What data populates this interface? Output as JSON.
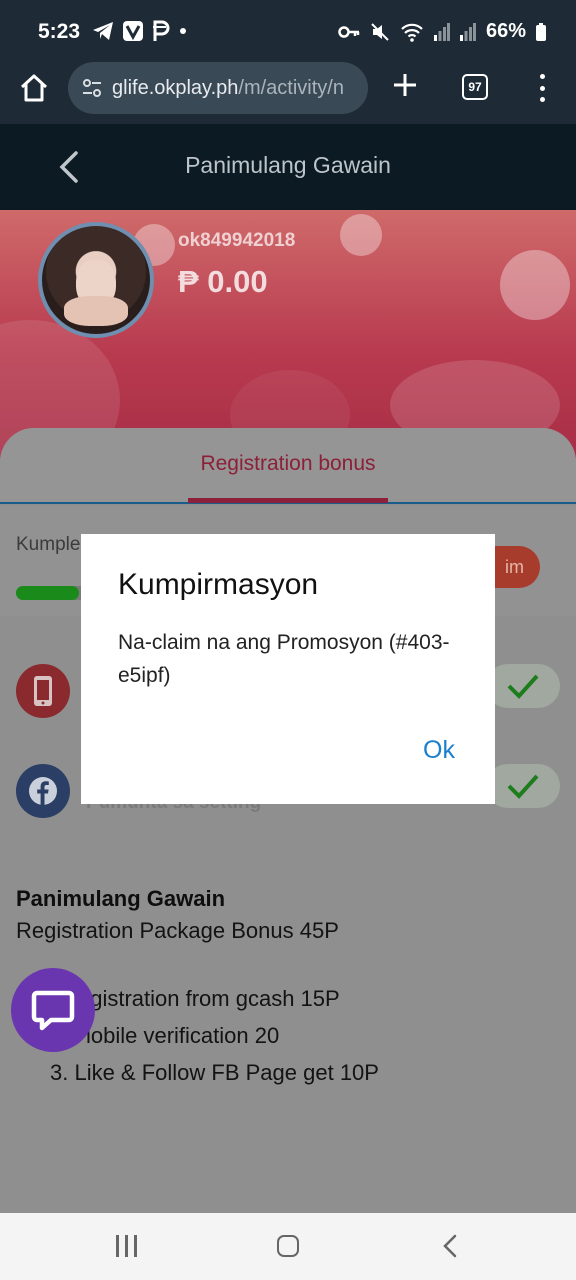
{
  "status_bar": {
    "time": "5:23",
    "battery": "66%"
  },
  "browser": {
    "url_host": "glife.okplay.ph",
    "url_path": "/m/activity/n",
    "tab_count": "97"
  },
  "header": {
    "title": "Panimulang Gawain"
  },
  "profile": {
    "username": "ok849942018",
    "balance": "₱ 0.00"
  },
  "tabs": [
    {
      "label": "Registration bonus",
      "active": true
    }
  ],
  "progress": {
    "label": "Kumple",
    "fraction": 0.15,
    "claim_label": "im"
  },
  "tasks": [
    {
      "icon": "phone-icon",
      "color": "#c8232f",
      "desc": "",
      "completed": true
    },
    {
      "icon": "facebook-icon",
      "color": "#2d54a0",
      "desc": "Pumunta sa setting",
      "completed": true
    }
  ],
  "info": {
    "title": "Panimulang Gawain",
    "subtitle": "Registration Package Bonus 45P",
    "items": [
      "Registration from gcash 15P",
      "Mobile verification 20",
      "3. Like & Follow FB Page get 10P"
    ],
    "item_visible_parts": [
      "egistration from gcash 15P",
      "lobile verification 20",
      "3. Like & Follow FB Page get 10P"
    ]
  },
  "modal": {
    "title": "Kumpirmasyon",
    "message": "Na-claim na ang Promosyon (#403-e5ipf)",
    "ok_label": "Ok"
  },
  "colors": {
    "accent_red": "#c8264e",
    "link_blue": "#1a7fce",
    "chat_purple": "#6a36b0",
    "success_green": "#1a8a1a"
  }
}
